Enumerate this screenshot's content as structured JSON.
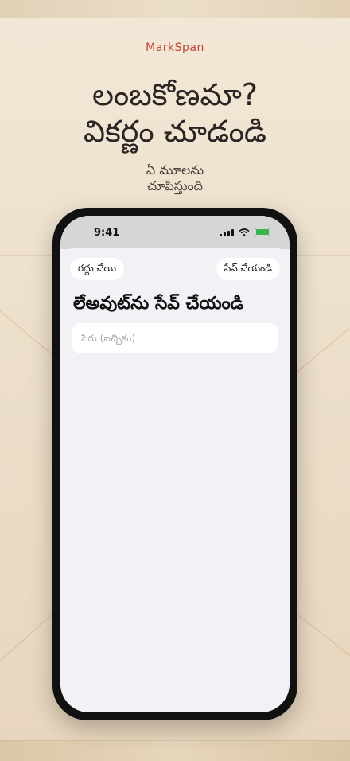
{
  "promo": {
    "brand": "MarkSpan",
    "headline_line1": "లంబకోణమా?",
    "headline_line2": "వికర్ణం చూడండి",
    "subhead_line1": "ఏ మూలను",
    "subhead_line2": "చూపిస్తుంది"
  },
  "status_bar": {
    "time": "9:41"
  },
  "sheet": {
    "cancel_label": "రద్దు చేయి",
    "save_label": "సేవ్ చేయండి",
    "title": "లేఅవుట్‌ను సేవ్ చేయండి",
    "name_placeholder": "పేరు (ఐచ్ఛికం)"
  },
  "colors": {
    "brand": "#c0463a",
    "background": "#efe3cf",
    "battery": "#39b54a"
  }
}
